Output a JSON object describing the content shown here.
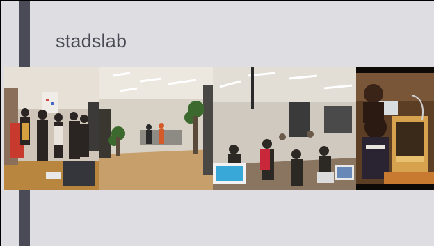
{
  "slide": {
    "title": "stadslab",
    "photos": [
      {
        "icon": "workshop-people-photo"
      },
      {
        "icon": "open-office-photo"
      },
      {
        "icon": "busy-lab-photo"
      },
      {
        "icon": "3d-printer-photo"
      }
    ]
  },
  "colors": {
    "background": "#dedee2",
    "accent_bar": "#4b4b58",
    "title_text": "#4a4a55",
    "frame": "#000000"
  }
}
